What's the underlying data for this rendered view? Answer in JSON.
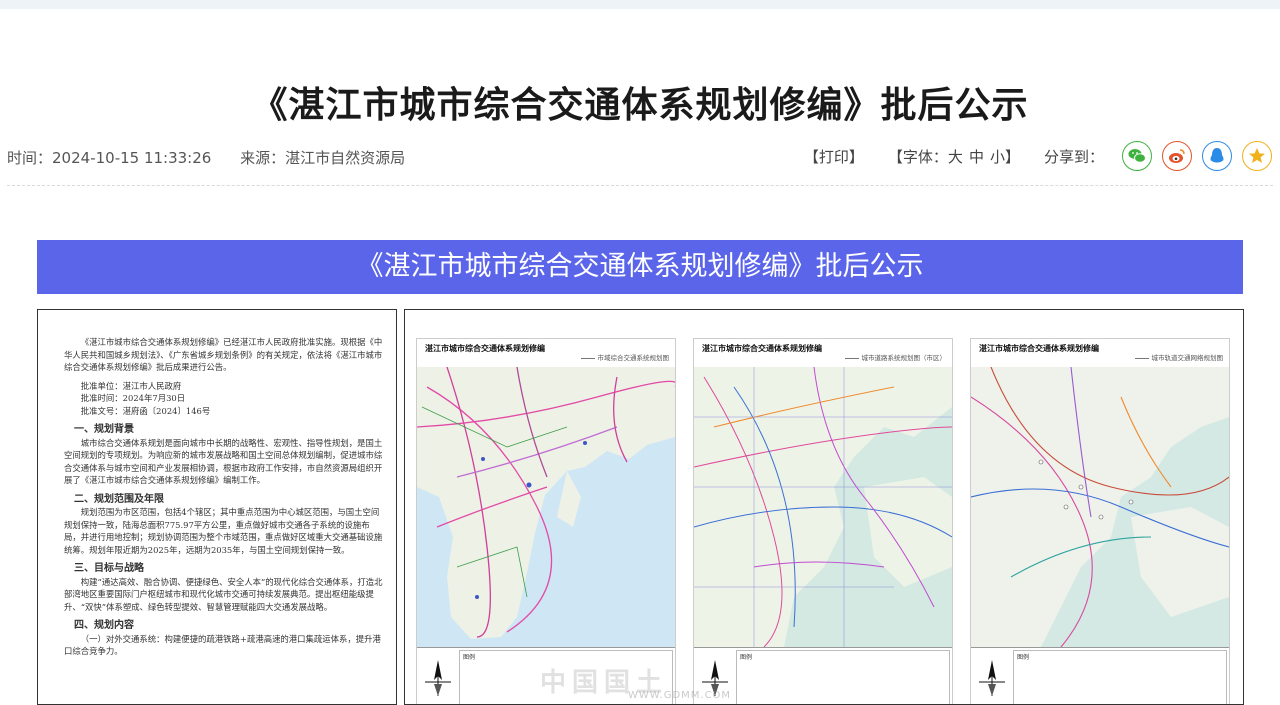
{
  "page": {
    "title": "《湛江市城市综合交通体系规划修编》批后公示",
    "time_label": "时间：",
    "time_value": "2024-10-15 11:33:26",
    "source_label": "来源：",
    "source_value": "湛江市自然资源局"
  },
  "toolbar": {
    "print": "【打印】",
    "font_prefix": "【字体：",
    "font_large": "大",
    "font_medium": "中",
    "font_small": "小",
    "font_suffix": "】",
    "share_label": "分享到："
  },
  "share_icons": [
    "wechat-icon",
    "weibo-icon",
    "qq-icon",
    "qzone-icon"
  ],
  "colors": {
    "banner": "#5b65ea",
    "wechat": "#3fb13f",
    "weibo": "#e2542b",
    "qq": "#2d8be8",
    "qzone": "#f0b21c"
  },
  "banner": {
    "text": "《湛江市城市综合交通体系规划修编》批后公示"
  },
  "document": {
    "intro": "《湛江市城市综合交通体系规划修编》已经湛江市人民政府批准实施。现根据《中华人民共和国城乡规划法》、《广东省城乡规划条例》的有关规定，依法将《湛江市城市综合交通体系规划修编》批后成果进行公告。",
    "approval_unit": "批准单位：湛江市人民政府",
    "approval_time": "批准时间：2024年7月30日",
    "approval_doc": "批准文号：湛府函〔2024〕146号",
    "s1_title": "一、规划背景",
    "s1_body": "城市综合交通体系规划是面向城市中长期的战略性、宏观性、指导性规划，是国土空间规划的专项规划。为响应新的城市发展战略和国土空间总体规划编制，促进城市综合交通体系与城市空间和产业发展相协调，根据市政府工作安排，市自然资源局组织开展了《湛江市城市综合交通体系规划修编》编制工作。",
    "s2_title": "二、规划范围及年限",
    "s2_body": "规划范围为市区范围，包括4个辖区；其中重点范围为中心城区范围，与国土空间规划保持一致，陆海总面积775.97平方公里，重点做好城市交通各子系统的设施布局，并进行用地控制；规划协调范围为整个市域范围，重点做好区域重大交通基础设施统筹。规划年限近期为2025年，远期为2035年，与国土空间规划保持一致。",
    "s3_title": "三、目标与战略",
    "s3_body": "构建“通达高效、融合协调、便捷绿色、安全人本”的现代化综合交通体系，打造北部湾地区重要国际门户枢纽城市和现代化城市交通可持续发展典范。提出枢纽能级提升、“双快”体系塑成、绿色转型提效、智慧管理赋能四大交通发展战略。",
    "s4_title": "四、规划内容",
    "s4_body": "（一）对外交通系统：构建便捷的疏港铁路+疏港高速的港口集疏运体系，提升港口综合竞争力。"
  },
  "maps": [
    {
      "title": "湛江市城市综合交通体系规划修编",
      "subtitle": "市域综合交通系统规划图"
    },
    {
      "title": "湛江市城市综合交通体系规划修编",
      "subtitle": "城市道路系统规划图（市区）"
    },
    {
      "title": "湛江市城市综合交通体系规划修编",
      "subtitle": "城市轨道交通网络规划图"
    }
  ],
  "map_legend_title": "图例",
  "watermark": {
    "text": "中国国土",
    "url": "WWW.GDMM.COM"
  }
}
